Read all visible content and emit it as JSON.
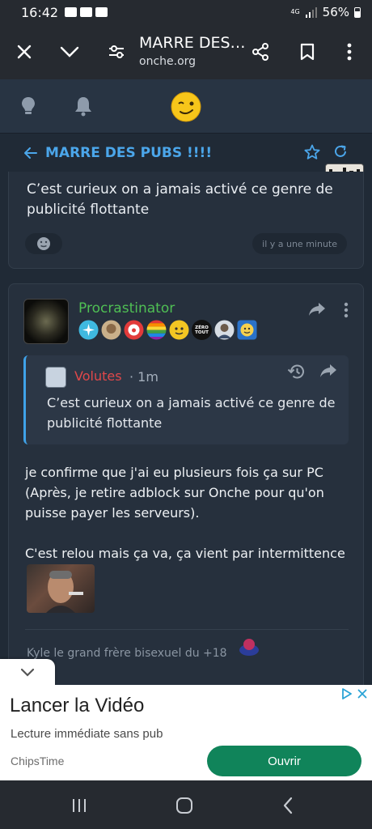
{
  "status": {
    "time": "16:42",
    "network": "4G",
    "battery": "56%"
  },
  "browser": {
    "title": "MARRE DES…",
    "url": "onche.org"
  },
  "topic": {
    "title": "MARRE DES PUBS !!!!"
  },
  "post1": {
    "text": "C’est curieux on a jamais activé ce genre de publicité flottante",
    "time": "il y a une minute"
  },
  "post2": {
    "username": "Procrastinator",
    "badges": [
      "sparkles-badge",
      "face-badge",
      "clown-badge",
      "rainbow-badge",
      "sticker-badge",
      "zero-tout-badge",
      "portrait-badge",
      "smiley-badge"
    ],
    "badge_text": "ZÉRO TOUT",
    "quote": {
      "user": "Volutes",
      "time": "1m",
      "text": "C’est curieux on a jamais activé ce genre de publicité flottante"
    },
    "paragraph1": "je confirme que j'ai eu plusieurs fois ça sur PC (Après, je retire adblock sur Onche pour qu'on puisse payer les serveurs).",
    "paragraph2": "C'est relou mais ça va, ça vient par intermittence",
    "signature": "Kyle le grand frère bisexuel du +18"
  },
  "ad": {
    "title": "Lancer la Vidéo",
    "subtitle": "Lecture immédiate sans pub",
    "brand": "ChipsTime",
    "button": "Ouvrir",
    "accent": "#10845a"
  },
  "colors": {
    "link": "#4ba6ea",
    "username": "#4fbf54",
    "quote_user": "#e0484a",
    "background": "#202a36"
  }
}
